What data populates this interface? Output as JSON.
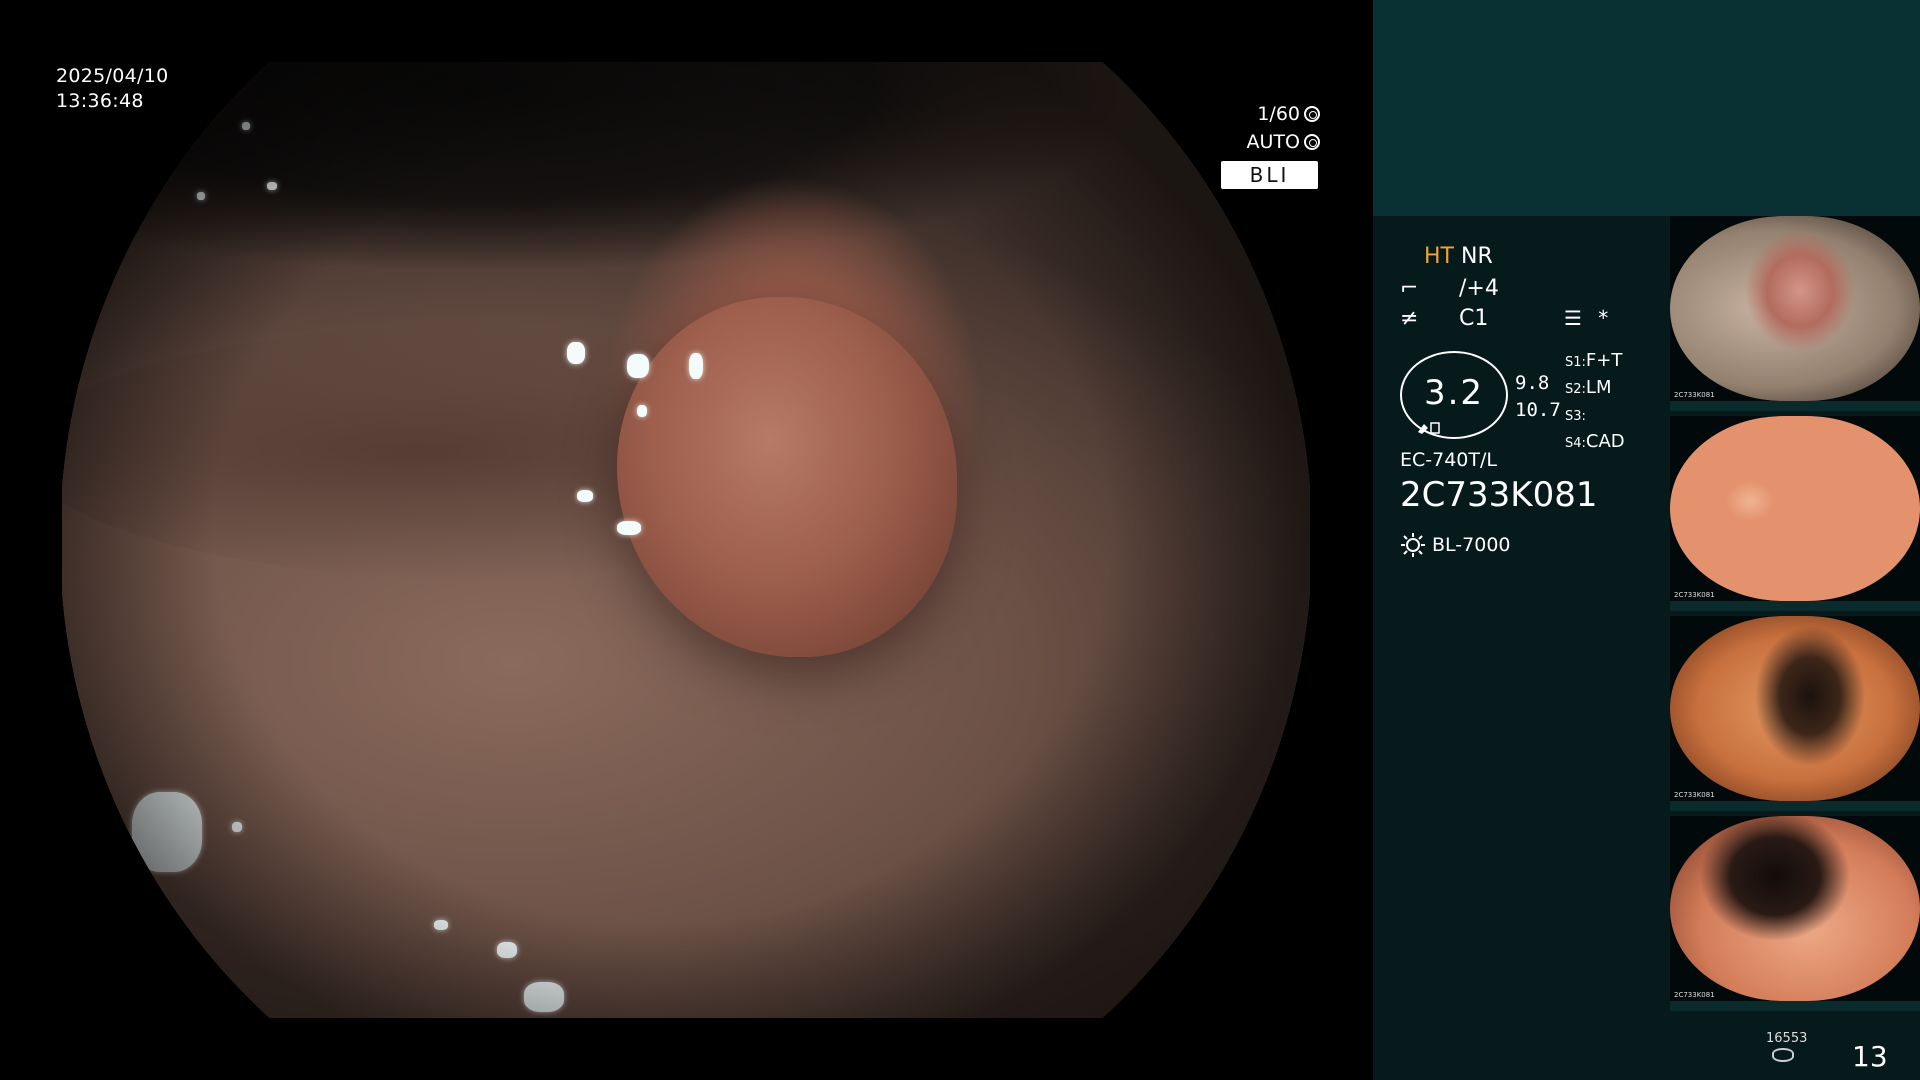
{
  "osd": {
    "date": "2025/04/10",
    "time": "13:36:48",
    "shutter": "1/60",
    "iris": "AUTO",
    "mode": "BLI"
  },
  "settings": {
    "ht": "HT",
    "nr": "NR",
    "enhance": "/+4",
    "color": "C1",
    "zoom": "3.2",
    "zoom_value_1": "9.8",
    "zoom_value_2": "10.7",
    "s1": "S1",
    "s1_value": "F+T",
    "s2": "S2",
    "s2_value": "LM",
    "s3": "S3",
    "s3_value": "",
    "s4": "S4",
    "s4_value": "CAD",
    "scope_model": "EC-740T/L",
    "serial": "2C733K081",
    "light_source": "BL-7000"
  },
  "thumbnails": [
    {
      "caption": "2C733K081"
    },
    {
      "caption": "2C733K081"
    },
    {
      "caption": "2C733K081"
    },
    {
      "caption": "2C733K081"
    }
  ],
  "counter": {
    "stored": "16553",
    "count": "13"
  },
  "colors": {
    "background": "#000000",
    "panel_top": "#093033",
    "panel": "#061a1c",
    "ht_accent": "#f0a33a"
  }
}
